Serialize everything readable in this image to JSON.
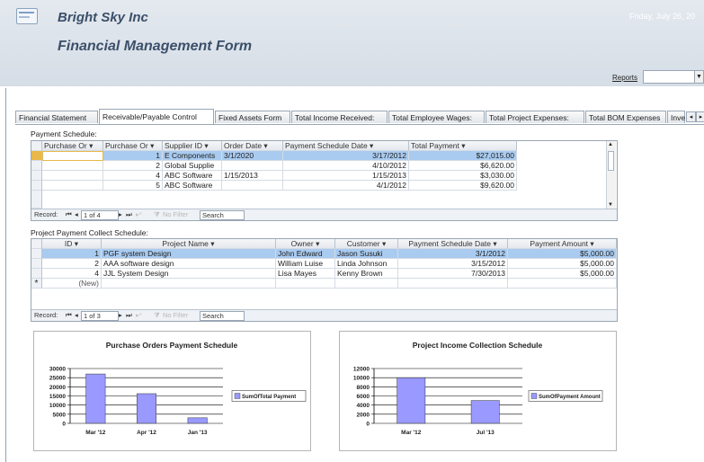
{
  "header": {
    "company": "Bright Sky Inc",
    "form_title": "Financial Management Form",
    "date": "Friday, July 26, 20",
    "reports_label": "Reports"
  },
  "tabs": [
    {
      "label": "Financial Statement",
      "active": false
    },
    {
      "label": "Receivable/Payable Control",
      "active": true
    },
    {
      "label": "Fixed Assets Form",
      "active": false
    },
    {
      "label": "Total Income Received:",
      "active": false
    },
    {
      "label": "Total Employee Wages:",
      "active": false
    },
    {
      "label": "Total Project Expenses:",
      "active": false
    },
    {
      "label": "Total BOM Expenses",
      "active": false
    },
    {
      "label": "Inve",
      "active": false
    }
  ],
  "payment_schedule": {
    "label": "Payment Schedule:",
    "columns": [
      "Purchase Or",
      "Purchase Or",
      "Supplier ID",
      "Order Date",
      "Payment Schedule Date",
      "Total Payment"
    ],
    "rows": [
      {
        "po_id": "",
        "po_num": "1",
        "supplier": "E Components",
        "order_date": "3/1/2020",
        "schedule_date": "3/17/2012",
        "total": "$27,015.00"
      },
      {
        "po_id": "",
        "po_num": "2",
        "supplier": "Global Supplie",
        "order_date": "",
        "schedule_date": "4/10/2012",
        "total": "$6,620.00"
      },
      {
        "po_id": "",
        "po_num": "4",
        "supplier": "ABC Software",
        "order_date": "1/15/2013",
        "schedule_date": "1/15/2013",
        "total": "$3,030.00"
      },
      {
        "po_id": "",
        "po_num": "5",
        "supplier": "ABC Software",
        "order_date": "",
        "schedule_date": "4/1/2012",
        "total": "$9,620.00"
      }
    ],
    "nav": {
      "record_label": "Record:",
      "position": "1 of 4",
      "filter": "No Filter",
      "search": "Search"
    }
  },
  "project_schedule": {
    "label": "Project Payment Collect Schedule:",
    "columns": [
      "ID",
      "Project Name",
      "Owner",
      "Customer",
      "Payment Schedule Date",
      "Payment Amount"
    ],
    "rows": [
      {
        "id": "1",
        "name": "PGF system Design",
        "owner": "John Edward",
        "customer": "Jason Susuki",
        "date": "3/1/2012",
        "amount": "$5,000.00"
      },
      {
        "id": "2",
        "name": "AAA software design",
        "owner": "William Luise",
        "customer": "Linda Johnson",
        "date": "3/15/2012",
        "amount": "$5,000.00"
      },
      {
        "id": "4",
        "name": "JJL System Design",
        "owner": "Lisa Mayes",
        "customer": "Kenny Brown",
        "date": "7/30/2013",
        "amount": "$5,000.00"
      }
    ],
    "new_row": "(New)",
    "nav": {
      "record_label": "Record:",
      "position": "1 of 3",
      "filter": "No Filter",
      "search": "Search"
    }
  },
  "chart_data": [
    {
      "type": "bar",
      "title": "Purchase Orders Payment Schedule",
      "categories": [
        "Mar '12",
        "Apr '12",
        "Jan '13"
      ],
      "series": [
        {
          "name": "SumOfTotal Payment",
          "values": [
            27015,
            16240,
            3030
          ]
        }
      ],
      "ylim": [
        0,
        30000
      ],
      "yticks": [
        0,
        5000,
        10000,
        15000,
        20000,
        25000,
        30000
      ],
      "grid": true,
      "legend": "right",
      "color": "#9999ff"
    },
    {
      "type": "bar",
      "title": "Project Income Collection Schedule",
      "categories": [
        "Mar '12",
        "Jul '13"
      ],
      "series": [
        {
          "name": "SumOfPayment Amount",
          "values": [
            10000,
            5000
          ]
        }
      ],
      "ylim": [
        0,
        12000
      ],
      "yticks": [
        0,
        2000,
        4000,
        6000,
        8000,
        10000,
        12000
      ],
      "grid": true,
      "legend": "right",
      "color": "#9999ff"
    }
  ]
}
